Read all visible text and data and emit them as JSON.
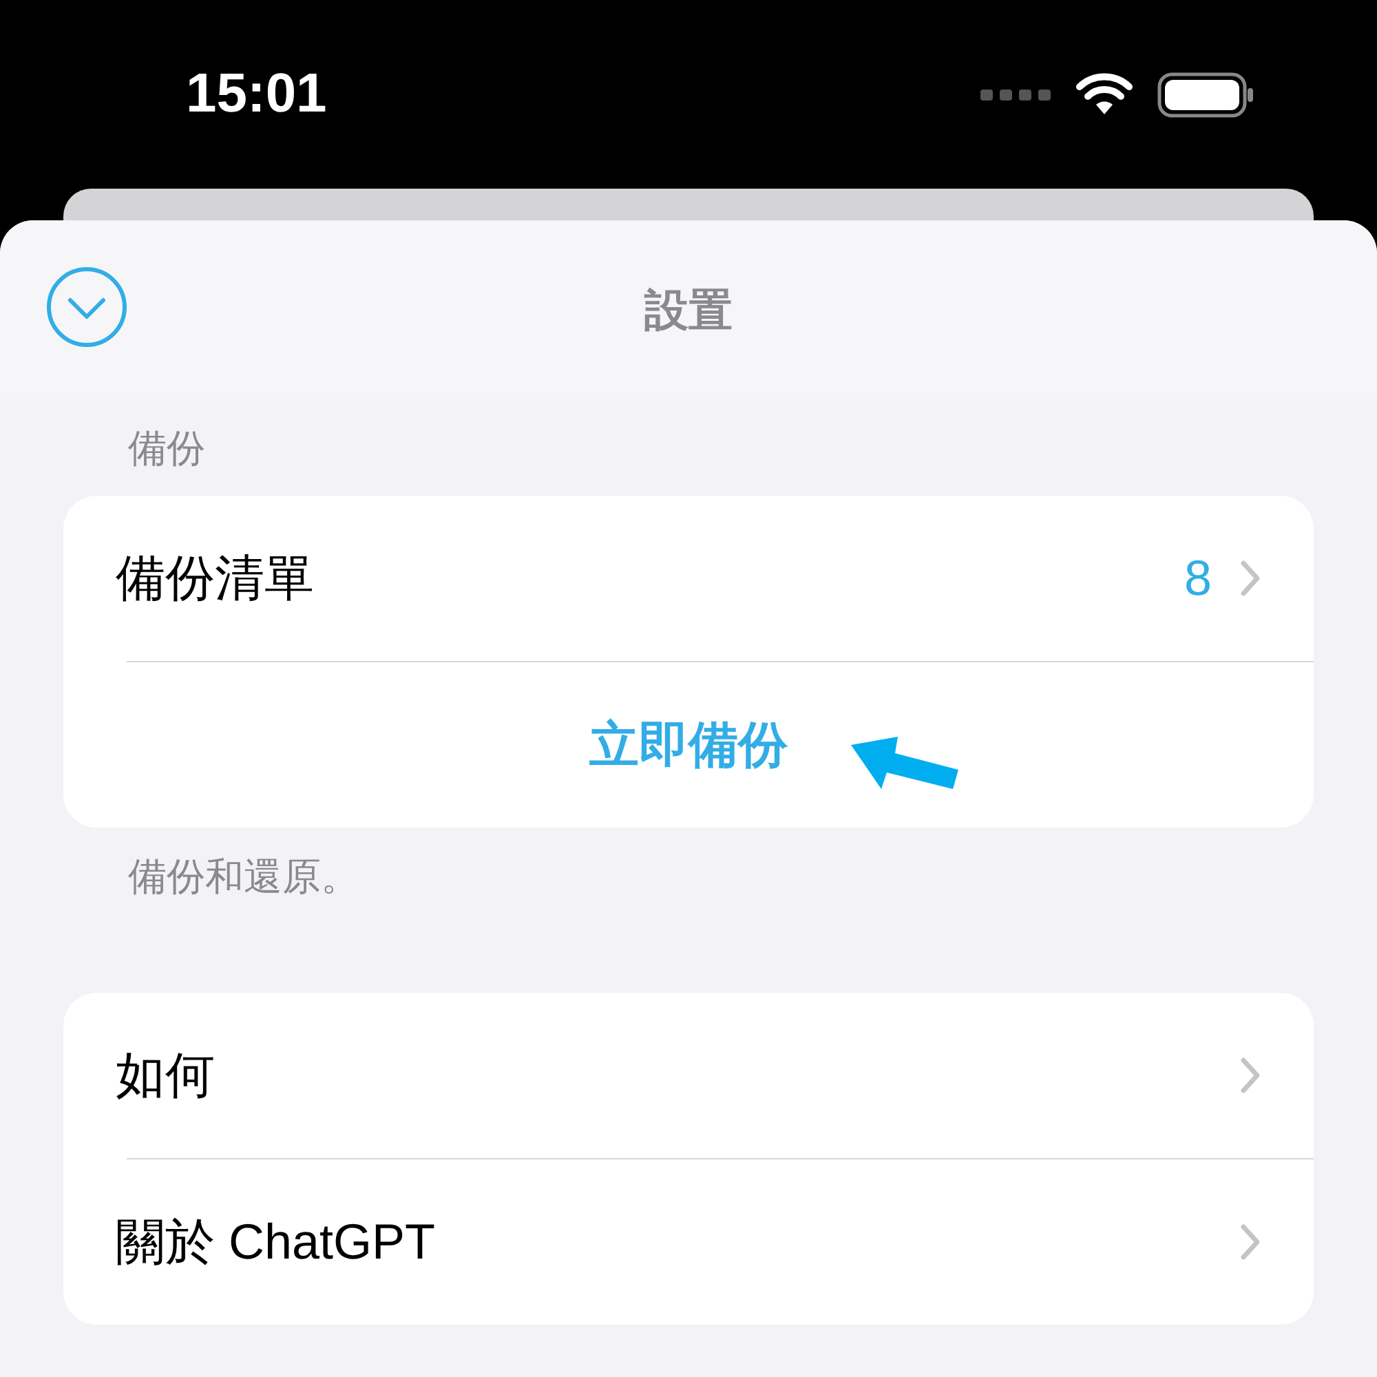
{
  "status_bar": {
    "time": "15:01"
  },
  "header": {
    "title": "設置"
  },
  "sections": [
    {
      "header": "備份",
      "footer": "備份和還原。",
      "rows": [
        {
          "kind": "nav",
          "label": "備份清單",
          "value": "8"
        },
        {
          "kind": "action",
          "label": "立即備份",
          "annotated": true
        }
      ]
    },
    {
      "rows": [
        {
          "kind": "nav",
          "label": "如何"
        },
        {
          "kind": "nav",
          "label": "關於 ChatGPT"
        }
      ]
    }
  ]
}
